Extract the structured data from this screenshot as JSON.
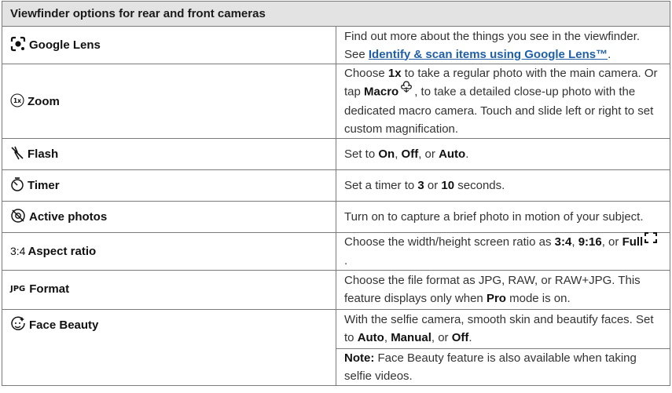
{
  "title": "Viewfinder options for rear and front cameras",
  "rows": {
    "lens": {
      "name": "Google Lens",
      "icon": "google-lens-icon",
      "desc_1": "Find out more about the things you see in the viewfinder. See ",
      "link": "Identify & scan items using Google Lens™",
      "desc_2": "."
    },
    "zoom": {
      "name": "Zoom",
      "icon": "zoom-1x-icon",
      "icon_text": "1x",
      "t1": "Choose ",
      "b1": "1x",
      "t2": " to take a regular photo with the main camera. Or tap ",
      "b2": "Macro",
      "t3": ", to take a detailed close-up photo with the dedicated macro camera. Touch and slide left or right to set custom magnification."
    },
    "flash": {
      "name": "Flash",
      "icon": "flash-off-icon",
      "t1": "Set to ",
      "b1": "On",
      "t2": ", ",
      "b2": "Off",
      "t3": ", or ",
      "b3": "Auto",
      "t4": "."
    },
    "timer": {
      "name": "Timer",
      "icon": "timer-icon",
      "t1": "Set a timer to ",
      "b1": "3",
      "t2": " or ",
      "b2": "10",
      "t3": " seconds."
    },
    "active": {
      "name": "Active photos",
      "icon": "active-photos-off-icon",
      "desc": "Turn on to capture a brief photo in motion of your subject."
    },
    "aspect": {
      "name": "Aspect ratio",
      "icon_text": "3:4",
      "t1": "Choose the width/height screen ratio as ",
      "b1": "3:4",
      "t2": ", ",
      "b2": "9:16",
      "t3": ", or ",
      "b3": "Full",
      "t4": "."
    },
    "format": {
      "name": "Format",
      "icon_text": "JPG",
      "t1": "Choose the file format as JPG, RAW, or RAW+JPG. This feature displays only when ",
      "b1": "Pro",
      "t2": " mode is on."
    },
    "beauty": {
      "name": "Face Beauty",
      "icon": "face-beauty-icon",
      "t1": "With the selfie camera, smooth skin and beautify faces. Set to ",
      "b1": "Auto",
      "t2": ", ",
      "b2": "Manual",
      "t3": ", or ",
      "b3": "Off",
      "t4": ".",
      "note_label": "Note:",
      "note_text": " Face Beauty feature is also available when taking selfie videos."
    }
  }
}
